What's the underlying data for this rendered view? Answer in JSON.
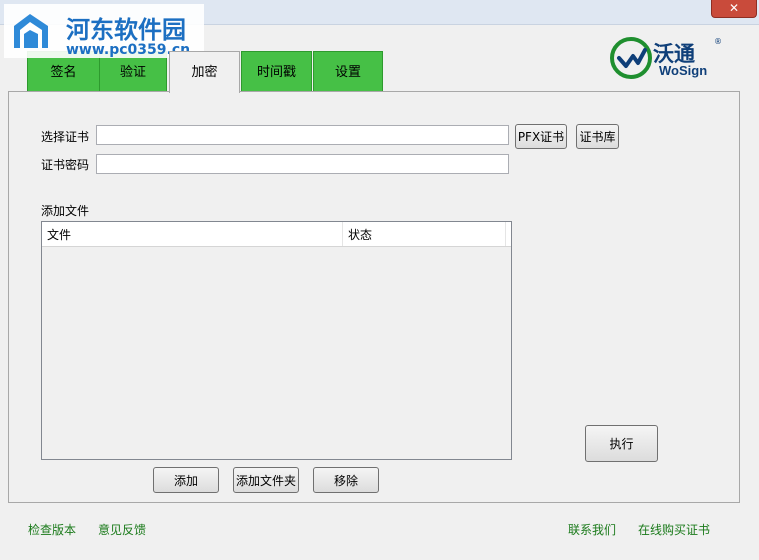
{
  "window": {
    "close_label": "✕"
  },
  "watermark": {
    "title": "河东软件园",
    "url": "www.pc0359.cn"
  },
  "brand": {
    "name": "沃通",
    "sub": "WoSign",
    "reg": "®"
  },
  "tabs": [
    {
      "label": "签名"
    },
    {
      "label": "验证"
    },
    {
      "label": "加密"
    },
    {
      "label": "时间戳"
    },
    {
      "label": "设置"
    }
  ],
  "form": {
    "cert_label": "选择证书",
    "cert_value": "",
    "pfx_button": "PFX证书",
    "store_button": "证书库",
    "password_label": "证书密码",
    "password_value": ""
  },
  "files": {
    "section_label": "添加文件",
    "columns": [
      "文件",
      "状态"
    ],
    "rows": []
  },
  "actions": {
    "add": "添加",
    "add_folder": "添加文件夹",
    "remove": "移除",
    "execute": "执行"
  },
  "footer": {
    "check_version": "检查版本",
    "feedback": "意见反馈",
    "contact": "联系我们",
    "buy": "在线购买证书"
  },
  "colors": {
    "tab_green": "#46c046",
    "link_green": "#1a7a1a",
    "brand_blue": "#0f3f79"
  }
}
